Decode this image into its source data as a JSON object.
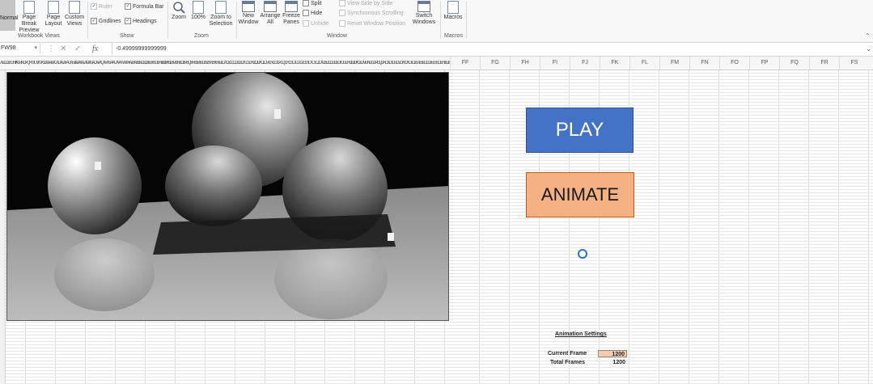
{
  "ribbon": {
    "normal": "Normal",
    "page_break_preview": "Page Break Preview",
    "page_layout": "Page Layout",
    "custom_views": "Custom Views",
    "ruler": "Ruler",
    "formula_bar": "Formula Bar",
    "gridlines": "Gridlines",
    "headings": "Headings",
    "zoom": "Zoom",
    "zoom_100": "100%",
    "zoom_to_selection": "Zoom to Selection",
    "new_window": "New Window",
    "arrange_all": "Arrange All",
    "freeze_panes": "Freeze Panes",
    "split": "Split",
    "hide": "Hide",
    "unhide": "Unhide",
    "view_side_by_side": "View Side by Side",
    "synchronous_scrolling": "Synchronous Scrolling",
    "reset_window_position": "Reset Window Position",
    "switch_windows": "Switch Windows",
    "macros": "Macros",
    "groups": {
      "workbook_views": "Workbook Views",
      "show": "Show",
      "zoom": "Zoom",
      "window": "Window",
      "macros": "Macros"
    }
  },
  "formula_bar": {
    "name_box": "FW98",
    "value": "-0.49999999999999"
  },
  "column_header_strip": "ABCDEFGHIJKLMNOPQRSTUVWXYZAAABACADAEAFAGAHAIAJAKALAMANAOAPAQARASATAUAVAWAXAYAZBABBBCBDBEBFBGBHBIBJBKBLBMBNBOBPBQBRBSBTBUBVBWBXBYBZCACBCCCDCECFCGCHCICJCKCLCMCNCOCPCQCRCSCTCUCVCWCXCYCZDADBDCDDDEDFDGDHDIDJDKDLDMDNDODPDQDRDSDTDUDVDWDXDYDZEAEBECEDEEEFEGEHEIEJEKELEMENEOEPEQERESETEUEVEWEXEYEZFAFBFCFDFE",
  "columns": [
    "FF",
    "FG",
    "FH",
    "FI",
    "FJ",
    "FK",
    "FL",
    "FM",
    "FN",
    "FO",
    "FP",
    "FQ",
    "FR",
    "FS"
  ],
  "buttons": {
    "play": "PLAY",
    "animate": "ANIMATE"
  },
  "settings": {
    "title": "Animation Settings",
    "current_frame_label": "Current Frame",
    "current_frame_value": "1200",
    "total_frames_label": "Total Frames",
    "total_frames_value": "1200"
  },
  "colors": {
    "play": "#4472c4",
    "animate": "#f4b183",
    "input_cell": "#f8cbad"
  }
}
